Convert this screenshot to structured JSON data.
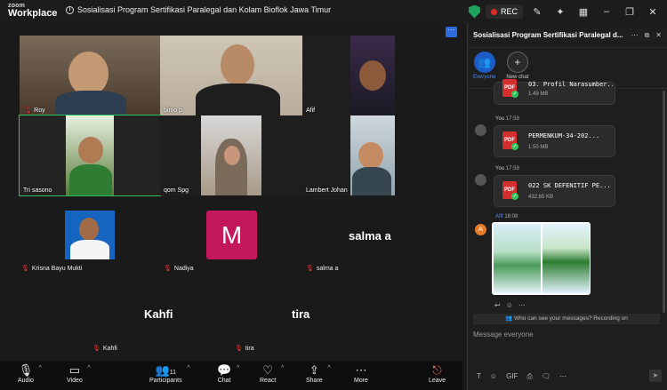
{
  "app": {
    "logo_top": "zoom",
    "logo_bottom": "Workplace"
  },
  "meeting": {
    "title": "Sosialisasi Program Sertifikasi Paralegal dan  Kolam Bioflok Jawa Timur"
  },
  "titlebar": {
    "rec_label": "REC"
  },
  "participants": {
    "roy": "Roy",
    "bimo": "bimo p",
    "afif": "Afif",
    "tri": "Tri sasono",
    "qom": "qom Spg",
    "lambert": "Lambert Johan",
    "krisna": "Krisna Bayu Mukti",
    "nadiya": "Nadiya",
    "nadiya_initial": "M",
    "salma_big": "salma a",
    "salma": "salma a",
    "kahfi_big": "Kahfi",
    "kahfi": "Kahfi",
    "tira_big": "tira",
    "tira": "tira"
  },
  "toolbar": {
    "audio": "Audio",
    "video": "Video",
    "participants": "Participants",
    "participants_count": "11",
    "chat": "Chat",
    "react": "React",
    "share": "Share",
    "more": "More",
    "leave": "Leave"
  },
  "chat": {
    "title": "Sosialisasi Program Sertifikasi Paralegal d...",
    "everyone": "Everyone",
    "new_chat": "New chat",
    "messages": [
      {
        "file": "03. Profil Narasumber...",
        "size": "1.49 MB"
      },
      {
        "sender": "You",
        "time": "17:59",
        "file": "PERMENKUM-34-202...",
        "size": "1.50 MB"
      },
      {
        "sender": "You",
        "time": "17:59",
        "file": "022 SK DEFENITIF PE...",
        "size": "432.65 KB"
      },
      {
        "sender": "Afif",
        "time": "18:08"
      }
    ],
    "avatar_initial": "A",
    "visibility": "Who can see your messages? Recording on",
    "placeholder": "Message everyone",
    "gif": "GIF"
  }
}
